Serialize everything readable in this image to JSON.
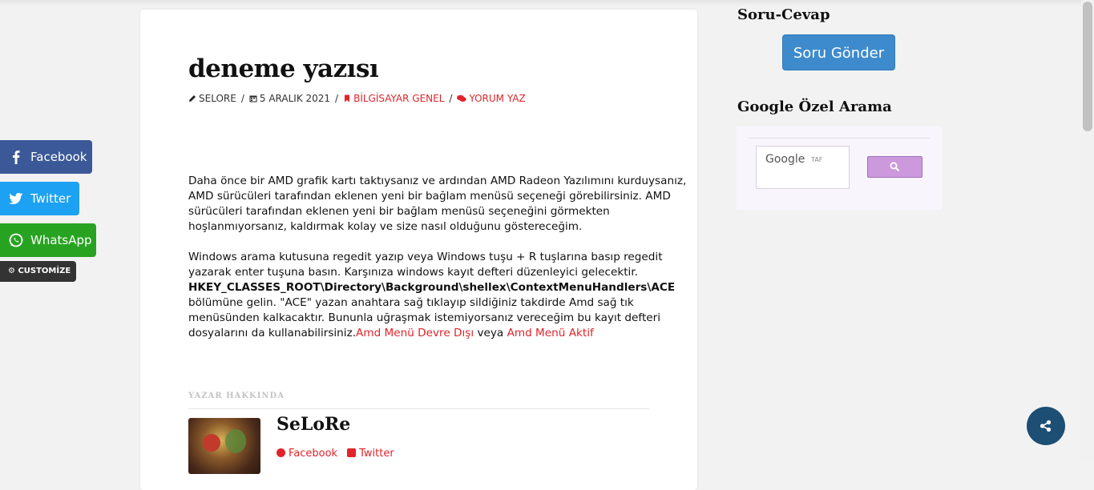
{
  "post": {
    "title": "deneme yazısı",
    "meta": {
      "author": "SELORE",
      "date": "5 ARALIK 2021",
      "category": "BİLGİSAYAR GENEL",
      "comment": "YORUM YAZ"
    },
    "paragraph1": "Daha önce bir AMD grafik kartı taktıysanız ve ardından AMD Radeon Yazılımını kurduysanız, AMD sürücüleri tarafından eklenen yeni bir bağlam menüsü seçeneği görebilirsiniz. AMD sürücüleri tarafından eklenen yeni bir bağlam menüsü seçeneğini görmekten hoşlanmıyorsanız, kaldırmak kolay ve size nasıl olduğunu göstereceğim.",
    "paragraph2_a": "Windows arama kutusuna regedit yazıp veya Windows tuşu + R tuşlarına basıp regedit yazarak enter tuşuna basın. Karşınıza windows kayıt defteri düzenleyici gelecektir. ",
    "paragraph2_key": "HKEY_CLASSES_ROOT\\Directory\\Background\\shellex\\ContextMenuHandlers\\ACE",
    "paragraph2_b": " bölümüne gelin. \"ACE\" yazan anahtara sağ tıklayıp sildiğiniz takdirde Amd sağ tık menüsünden kalkacaktır. Bununla uğraşmak istemiyorsanız vereceğim bu kayıt defteri dosyalarını da kullanabilirsiniz.",
    "link1": "Amd Menü Devre Dışı",
    "link_sep": " veya ",
    "link2": "Amd Menü Aktif"
  },
  "author_box": {
    "heading": "YAZAR HAKKINDA",
    "name": "SeLoRe",
    "facebook": "Facebook",
    "twitter": "Twitter"
  },
  "sidebar": {
    "qa_title": "Soru-Cevap",
    "qa_button": "Soru Gönder",
    "search_title": "Google Özel Arama",
    "search_brand": "Google",
    "search_placeholder": "TAF"
  },
  "social": {
    "facebook": "Facebook",
    "twitter": "Twitter",
    "whatsapp": "WhatsApp",
    "customize": "CUSTOMİZE"
  },
  "colors": {
    "accent_red": "#e0242a",
    "facebook": "#3b5998",
    "twitter": "#1da1f2",
    "whatsapp": "#27a321",
    "button_blue": "#3d8bcd",
    "fab": "#1d4e74"
  }
}
